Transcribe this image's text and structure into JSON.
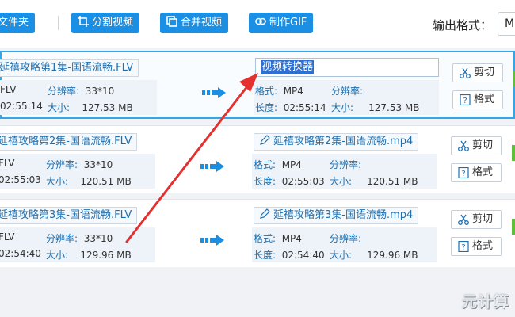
{
  "toolbar": {
    "buttons": [
      {
        "label": "加文件夹",
        "icon": "folder-icon"
      },
      {
        "label": "分割视频",
        "icon": "crop-icon"
      },
      {
        "label": "合并视频",
        "icon": "merge-icon"
      },
      {
        "label": "制作GIF",
        "icon": "gif-icon"
      }
    ],
    "format_label": "输出格式：",
    "format_value": "M"
  },
  "labels": {
    "format": "格式:",
    "resolution": "分辨率:",
    "duration": "长度:",
    "size": "大小:",
    "cut": "剪切",
    "fmt": "格式"
  },
  "rows": [
    {
      "src_name": "延禧攻略第1集-国语流畅.FLV",
      "src_format": "FLV",
      "src_resolution": "33*10",
      "src_duration": "02:55:14",
      "src_size": "127.53 MB",
      "dst_name": "视频转换器",
      "dst_editing": true,
      "dst_format": "MP4",
      "dst_resolution": "",
      "dst_duration": "02:55:14",
      "dst_size": "127.53 MB"
    },
    {
      "src_name": "延禧攻略第2集-国语流畅.FLV",
      "src_format": "FLV",
      "src_resolution": "33*10",
      "src_duration": "02:55:03",
      "src_size": "120.51 MB",
      "dst_name": "延禧攻略第2集-国语流畅.mp4",
      "dst_editing": false,
      "dst_format": "MP4",
      "dst_resolution": "",
      "dst_duration": "02:55:03",
      "dst_size": "120.51 MB"
    },
    {
      "src_name": "延禧攻略第3集-国语流畅.FLV",
      "src_format": "FLV",
      "src_resolution": "33*10",
      "src_duration": "02:54:40",
      "src_size": "129.96 MB",
      "dst_name": "延禧攻略第3集-国语流畅.mp4",
      "dst_editing": false,
      "dst_format": "MP4",
      "dst_resolution": "",
      "dst_duration": "02:54:40",
      "dst_size": "129.96 MB"
    }
  ],
  "watermark": "元计算",
  "colors": {
    "accent": "#1a8fe3",
    "annotation": "#e53030",
    "selection": "#2d6fd2"
  }
}
